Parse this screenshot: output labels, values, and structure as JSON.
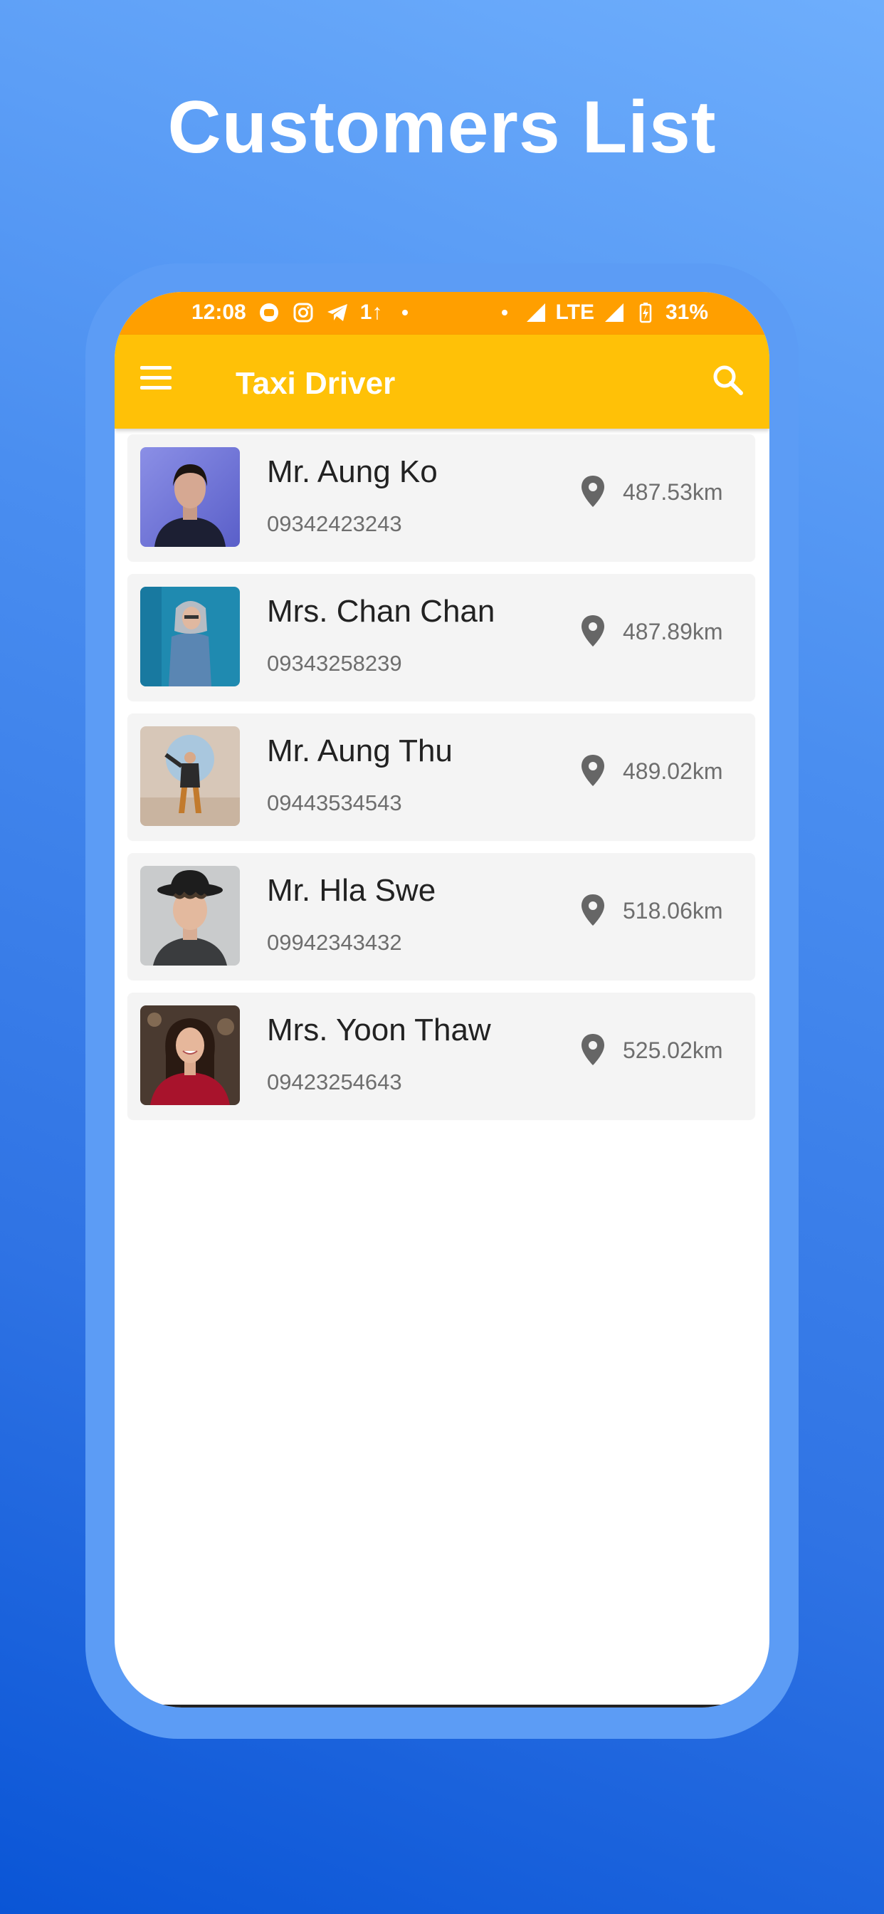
{
  "promo": {
    "title": "Customers List"
  },
  "status_bar": {
    "time": "12:08",
    "network": "LTE",
    "battery": "31%",
    "data_indicator": "1↑"
  },
  "app_bar": {
    "title": "Taxi Driver"
  },
  "colors": {
    "status_bar": "#ff9f00",
    "app_bar": "#ffc107",
    "card_bg": "#f4f4f4"
  },
  "customers": [
    {
      "name": "Mr. Aung Ko",
      "phone": "09342423243",
      "distance": "487.53km"
    },
    {
      "name": "Mrs. Chan Chan",
      "phone": "09343258239",
      "distance": "487.89km"
    },
    {
      "name": "Mr. Aung Thu",
      "phone": "09443534543",
      "distance": "489.02km"
    },
    {
      "name": "Mr. Hla Swe",
      "phone": "09942343432",
      "distance": "518.06km"
    },
    {
      "name": "Mrs. Yoon Thaw",
      "phone": "09423254643",
      "distance": "525.02km"
    }
  ]
}
